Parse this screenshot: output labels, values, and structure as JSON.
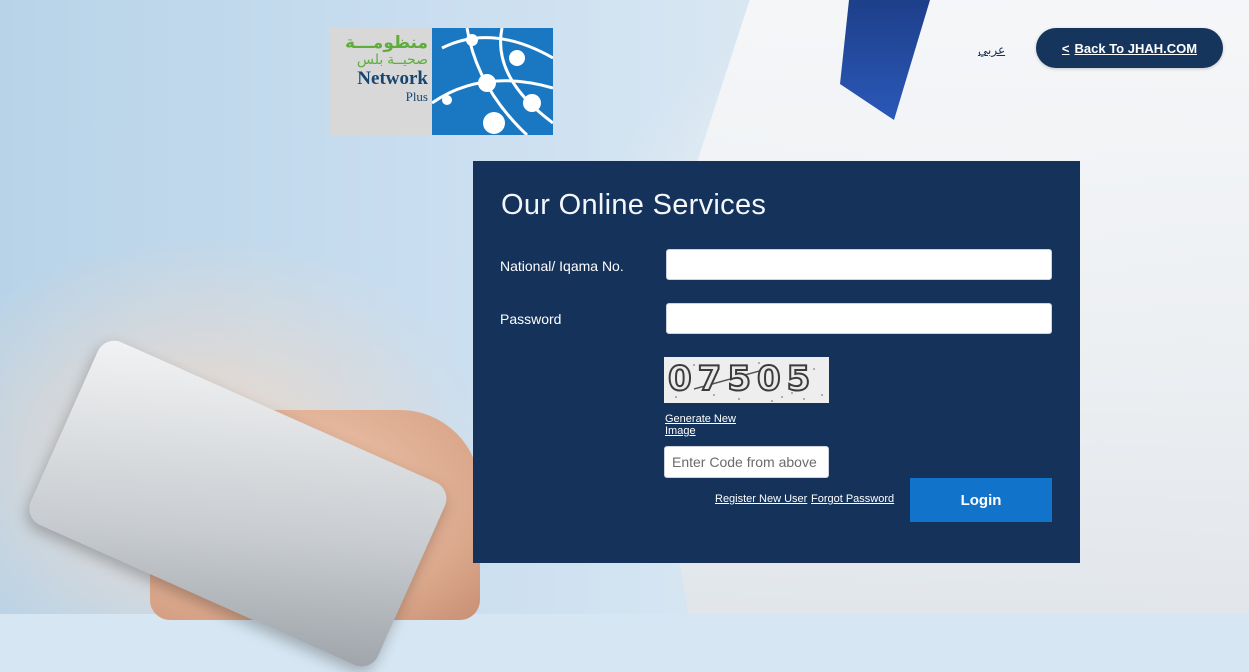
{
  "logo": {
    "arabic_line1": "منظومـــة",
    "arabic_line2": "صحيــة بلس",
    "english_line1": "Network",
    "english_line2": "Plus"
  },
  "header": {
    "language_link": "عربي",
    "back_button": "Back To JHAH.COM"
  },
  "form": {
    "title": "Our Online Services",
    "national_id_label": "National/ Iqama No.",
    "password_label": "Password",
    "captcha_code": "07505",
    "generate_link": "Generate New Image",
    "code_placeholder": "Enter Code from above",
    "register_link": "Register New User",
    "forgot_link": "Forgot Password",
    "login_button": "Login"
  },
  "colors": {
    "panel": "#14325a",
    "login": "#1173c9",
    "back": "#16355c"
  }
}
